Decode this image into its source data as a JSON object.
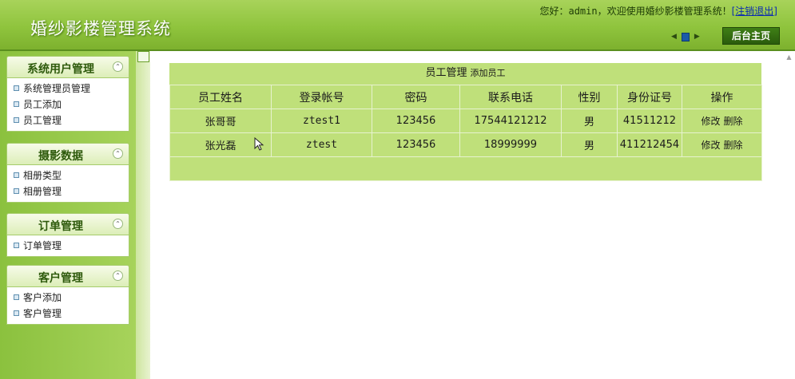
{
  "header": {
    "app_title": "婚纱影楼管理系统",
    "greeting_prefix": "您好：",
    "username": "admin",
    "greeting_suffix": "，欢迎使用婚纱影楼管理系统！",
    "logout_label": "[注销退出]",
    "home_button": "后台主页"
  },
  "sidebar": {
    "groups": [
      {
        "title": "系统用户管理",
        "items": [
          "系统管理员管理",
          "员工添加",
          "员工管理"
        ]
      },
      {
        "title": "摄影数据",
        "items": [
          "相册类型",
          "相册管理"
        ]
      },
      {
        "title": "订单管理",
        "items": [
          "订单管理"
        ]
      },
      {
        "title": "客户管理",
        "items": [
          "客户添加",
          "客户管理"
        ]
      }
    ]
  },
  "panel": {
    "title": "员工管理",
    "add_link": "添加员工",
    "columns": [
      "员工姓名",
      "登录帐号",
      "密码",
      "联系电话",
      "性别",
      "身份证号",
      "操作"
    ],
    "rows": [
      {
        "name": "张哥哥",
        "account": "ztest1",
        "password": "123456",
        "phone": "17544121212",
        "gender": "男",
        "id_no": "41511212",
        "edit": "修改",
        "delete": "删除"
      },
      {
        "name": "张光磊",
        "account": "ztest",
        "password": "123456",
        "phone": "18999999",
        "gender": "男",
        "id_no": "411212454",
        "edit": "修改",
        "delete": "删除"
      }
    ]
  },
  "colors": {
    "accent": "#8fc43d",
    "panel": "#bfe07a",
    "link": "#0b2bb0"
  }
}
